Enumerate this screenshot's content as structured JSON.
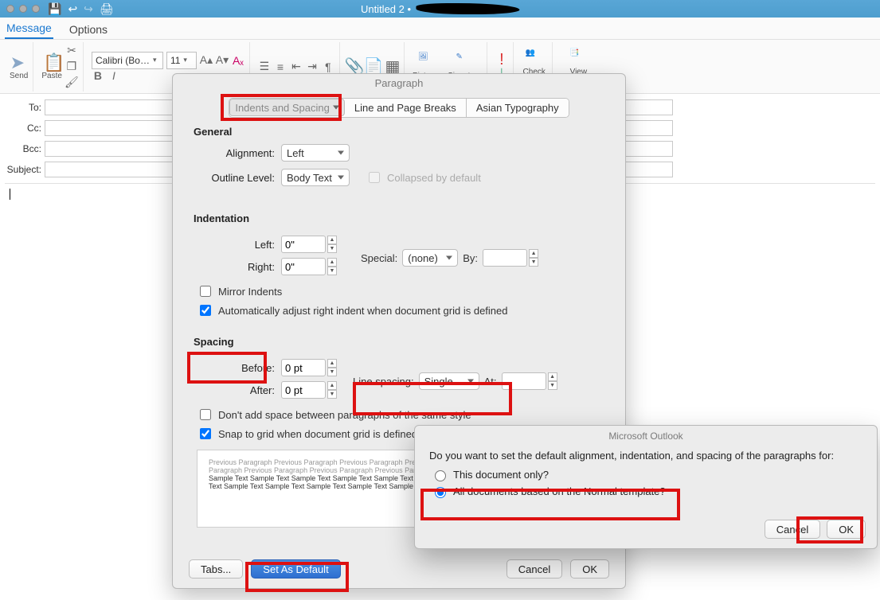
{
  "window": {
    "title": "Untitled 2 •"
  },
  "ribbon_tabs": {
    "message": "Message",
    "options": "Options"
  },
  "ribbon": {
    "send": "Send",
    "paste": "Paste",
    "font_name": "Calibri (Bo…",
    "font_size": "11",
    "pictures": "Pictures",
    "signature": "Signature",
    "check_names": "Check\nNames",
    "view_templates": "View\nTemplates"
  },
  "compose": {
    "to": "To:",
    "cc": "Cc:",
    "bcc": "Bcc:",
    "subject": "Subject:"
  },
  "dialog": {
    "title": "Paragraph",
    "tabs": {
      "indents": "Indents and Spacing",
      "breaks": "Line and Page Breaks",
      "asian": "Asian Typography"
    },
    "general_h": "General",
    "alignment_l": "Alignment:",
    "alignment_v": "Left",
    "outline_l": "Outline Level:",
    "outline_v": "Body Text",
    "collapsed": "Collapsed by default",
    "indent_h": "Indentation",
    "left_l": "Left:",
    "left_v": "0\"",
    "right_l": "Right:",
    "right_v": "0\"",
    "special_l": "Special:",
    "special_v": "(none)",
    "by_l": "By:",
    "mirror": "Mirror Indents",
    "autogrid": "Automatically adjust right indent when document grid is defined",
    "spacing_h": "Spacing",
    "before_l": "Before:",
    "before_v": "0 pt",
    "after_l": "After:",
    "after_v": "0 pt",
    "linesp_l": "Line spacing:",
    "linesp_v": "Single",
    "at_l": "At:",
    "noadd": "Don't add space between paragraphs of the same style",
    "snap": "Snap to grid when document grid is defined",
    "preview1": "Previous Paragraph Previous Paragraph Previous Paragraph Previous Paragraph Previous Paragraph Previous",
    "preview2": "Paragraph Previous Paragraph Previous Paragraph Previous Paragraph",
    "preview3": "Sample Text Sample Text Sample Text Sample Text Sample Text Sample Text Sample Text Sample Text Sample",
    "preview4": "Text Sample Text Sample Text Sample Text Sample Text Sample Text",
    "tabs_btn": "Tabs...",
    "default_btn": "Set As Default",
    "cancel_btn": "Cancel",
    "ok_btn": "OK"
  },
  "popup": {
    "title": "Microsoft Outlook",
    "question": "Do you want to set the default alignment, indentation, and spacing of the paragraphs for:",
    "opt1": "This document only?",
    "opt2": "All documents based on the Normal template?",
    "cancel": "Cancel",
    "ok": "OK"
  }
}
